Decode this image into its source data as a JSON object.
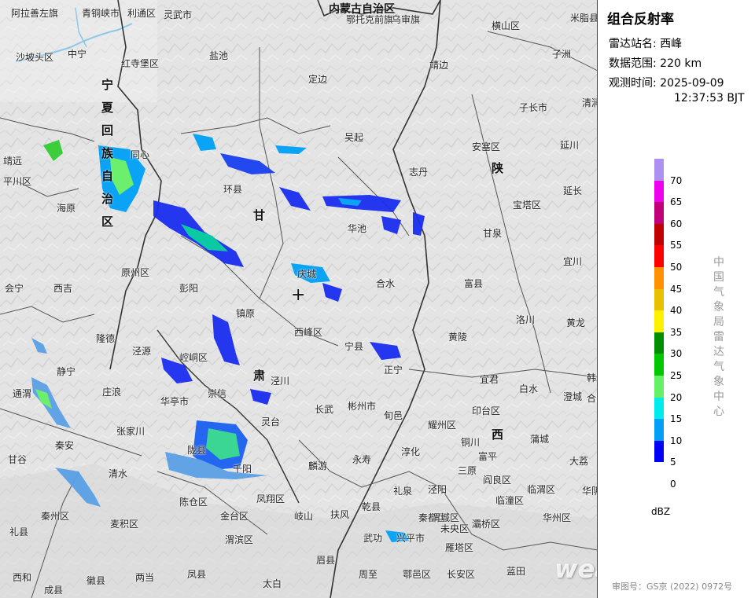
{
  "panel": {
    "title": "组合反射率",
    "station_label": "雷达站名:",
    "station_value": "西峰",
    "range_label": "数据范围:",
    "range_value": "220 km",
    "time_label": "观测时间:",
    "time_date": "2025-09-09",
    "time_clock": "12:37:53 BJT",
    "unit": "dBZ",
    "org": "中国气象局雷达气象中心"
  },
  "legend": {
    "levels": [
      {
        "label": "70",
        "color": "#ad90f0"
      },
      {
        "label": "65",
        "color": "#f000f0"
      },
      {
        "label": "60",
        "color": "#c00078"
      },
      {
        "label": "55",
        "color": "#c00000"
      },
      {
        "label": "50",
        "color": "#ff0000"
      },
      {
        "label": "45",
        "color": "#ff9000"
      },
      {
        "label": "40",
        "color": "#e7c000"
      },
      {
        "label": "35",
        "color": "#fff000"
      },
      {
        "label": "30",
        "color": "#008f00"
      },
      {
        "label": "25",
        "color": "#00c800"
      },
      {
        "label": "20",
        "color": "#66f066"
      },
      {
        "label": "15",
        "color": "#00ecec"
      },
      {
        "label": "10",
        "color": "#00a0f6"
      },
      {
        "label": "5",
        "color": "#0000f6"
      },
      {
        "label": "0",
        "color": "#ffffff"
      }
    ]
  },
  "watermark": "weather.com.cn",
  "map_number": "审图号：GS京 (2022) 0972号",
  "map": {
    "regions": {
      "inner_mongolia": "内蒙古自治区",
      "ningxia_chars": [
        "宁",
        "夏",
        "回",
        "族",
        "自",
        "治",
        "区"
      ],
      "gansu_chars": [
        "甘",
        "肃"
      ],
      "shaanxi_chars": [
        "陕",
        "西"
      ],
      "radar_marker": "+"
    },
    "places": [
      "阿拉善左旗",
      "青铜峡市",
      "利通区",
      "灵武市",
      "鄂托克前旗",
      "乌审旗",
      "米脂县",
      "横山区",
      "沙坡头区",
      "中宁",
      "红寺堡区",
      "盐池",
      "定边",
      "靖边",
      "子洲",
      "同心",
      "吴起",
      "安塞区",
      "子长市",
      "清涧",
      "延川",
      "靖远",
      "平川区",
      "海原",
      "环县",
      "志丹",
      "宝塔区",
      "延长",
      "华池",
      "甘泉",
      "原州区",
      "庆城",
      "合水",
      "富县",
      "宜川",
      "会宁",
      "西吉",
      "彭阳",
      "镇原",
      "西峰区",
      "宁县",
      "洛川",
      "黄龙",
      "隆德",
      "泾源",
      "崆峒区",
      "正宁",
      "黄陵",
      "宜君",
      "白水",
      "澄城",
      "韩城",
      "静宁",
      "庄浪",
      "华亭市",
      "崇信",
      "泾川",
      "长武",
      "彬州市",
      "旬邑",
      "耀州区",
      "印台区",
      "合阳",
      "通渭",
      "张家川",
      "灵台",
      "淳化",
      "铜川",
      "富平",
      "蒲城",
      "大荔",
      "甘谷",
      "秦安",
      "陇县",
      "千阳",
      "麟游",
      "永寿",
      "三原",
      "阎良区",
      "清水",
      "陈仓区",
      "凤翔区",
      "乾县",
      "礼泉",
      "泾阳",
      "临潼区",
      "临渭区",
      "华州区",
      "华阴市",
      "秦州区",
      "麦积区",
      "金台区",
      "岐山",
      "扶风",
      "武功",
      "兴平市",
      "秦都区",
      "渭城区",
      "未央区",
      "灞桥区",
      "雁塔区",
      "礼县",
      "渭滨区",
      "眉县",
      "周至",
      "鄠邑区",
      "长安区",
      "蓝田",
      "西和",
      "成县",
      "徽县",
      "两当",
      "凤县",
      "太白"
    ]
  }
}
